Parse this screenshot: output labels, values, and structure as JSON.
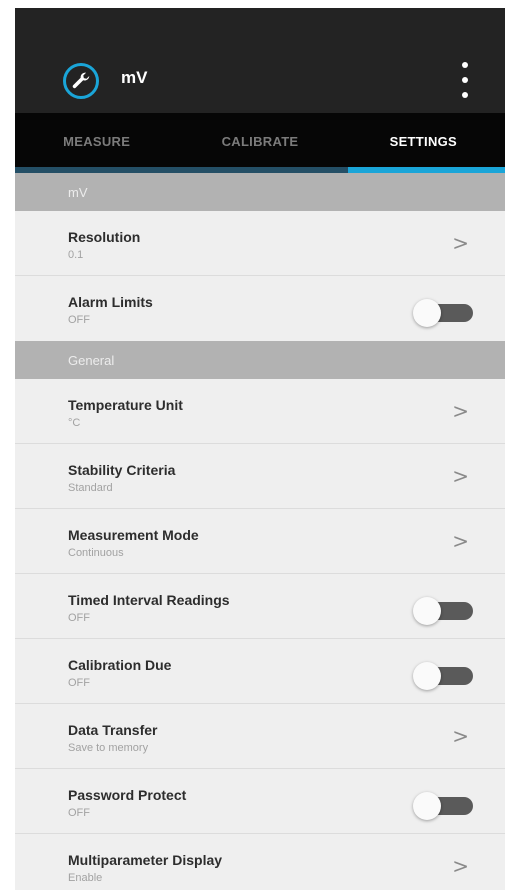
{
  "app": {
    "title": "mV",
    "logo_icon": "wrench-icon",
    "accent_color": "#1aa5d8"
  },
  "tabs": [
    {
      "label": "MEASURE"
    },
    {
      "label": "CALIBRATE"
    },
    {
      "label": "SETTINGS"
    }
  ],
  "active_tab": "SETTINGS",
  "sections": {
    "mv": {
      "header": "mV"
    },
    "general": {
      "header": "General"
    }
  },
  "settings": {
    "resolution": {
      "title": "Resolution",
      "value": "0.1"
    },
    "alarm_limits": {
      "title": "Alarm Limits",
      "value": "OFF"
    },
    "temperature_unit": {
      "title": "Temperature Unit",
      "value": "°C"
    },
    "stability_criteria": {
      "title": "Stability Criteria",
      "value": "Standard"
    },
    "measurement_mode": {
      "title": "Measurement Mode",
      "value": "Continuous"
    },
    "timed_interval": {
      "title": "Timed Interval Readings",
      "value": "OFF"
    },
    "calibration_due": {
      "title": "Calibration Due",
      "value": "OFF"
    },
    "data_transfer": {
      "title": "Data Transfer",
      "value": "Save to memory"
    },
    "password_protect": {
      "title": "Password Protect",
      "value": "OFF"
    },
    "multiparameter_display": {
      "title": "Multiparameter Display",
      "value": "Enable"
    }
  },
  "chevron": ">"
}
